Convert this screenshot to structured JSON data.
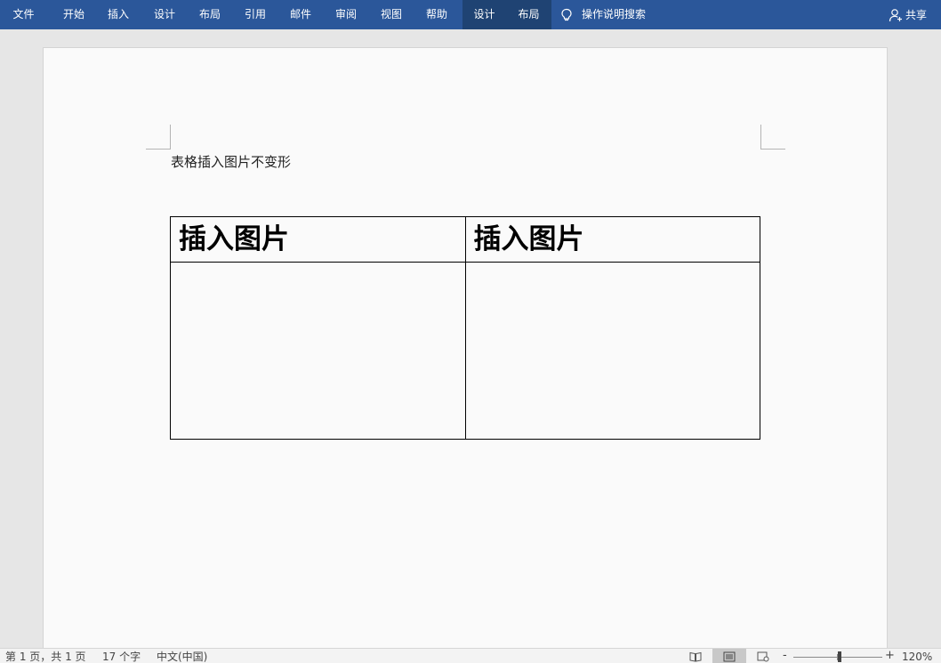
{
  "ribbon": {
    "tabs": [
      {
        "label": "文件"
      },
      {
        "label": "开始"
      },
      {
        "label": "插入"
      },
      {
        "label": "设计"
      },
      {
        "label": "布局"
      },
      {
        "label": "引用"
      },
      {
        "label": "邮件"
      },
      {
        "label": "审阅"
      },
      {
        "label": "视图"
      },
      {
        "label": "帮助"
      }
    ],
    "context_tabs": [
      {
        "label": "设计"
      },
      {
        "label": "布局"
      }
    ],
    "search_label": "操作说明搜索",
    "share_label": "共享",
    "bar_color": "#2b579a",
    "context_color": "#1f4373"
  },
  "document": {
    "paragraph": "表格插入图片不变形",
    "table": {
      "header_cells": [
        "插入图片",
        "插入图片"
      ],
      "body_cells": [
        "",
        ""
      ]
    }
  },
  "status": {
    "page_info": "第 1 页，共 1 页",
    "word_count": "17 个字",
    "language": "中文(中国)",
    "zoom_minus": "-",
    "zoom_plus": "+",
    "zoom_level": "120%"
  }
}
